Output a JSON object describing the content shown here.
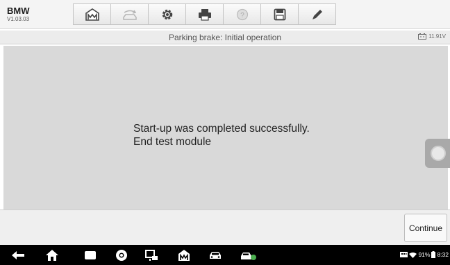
{
  "app": {
    "name": "BMW",
    "version": "V1.03.03"
  },
  "toolbar": {
    "buttons": [
      {
        "icon": "home-icon"
      },
      {
        "icon": "vehicle-swap-icon"
      },
      {
        "icon": "settings-icon"
      },
      {
        "icon": "print-icon"
      },
      {
        "icon": "help-icon"
      },
      {
        "icon": "save-icon"
      },
      {
        "icon": "edit-icon"
      }
    ]
  },
  "subheader": {
    "title": "Parking brake: Initial operation",
    "battery_voltage": "11.91V"
  },
  "message": {
    "line1": "Start-up was completed successfully.",
    "line2": "End test module"
  },
  "footer": {
    "continue_label": "Continue"
  },
  "system_bar": {
    "icons": [
      "back-icon",
      "home-icon",
      "recents-icon",
      "browser-icon",
      "remote-icon",
      "maxisys-icon",
      "car-icon",
      "vci-icon"
    ],
    "battery_percent": "91%",
    "time": "8:32"
  },
  "colors": {
    "content_bg": "#d9d9d9",
    "toolbar_bg": "#f4f4f4",
    "nav_bg": "#000000"
  }
}
